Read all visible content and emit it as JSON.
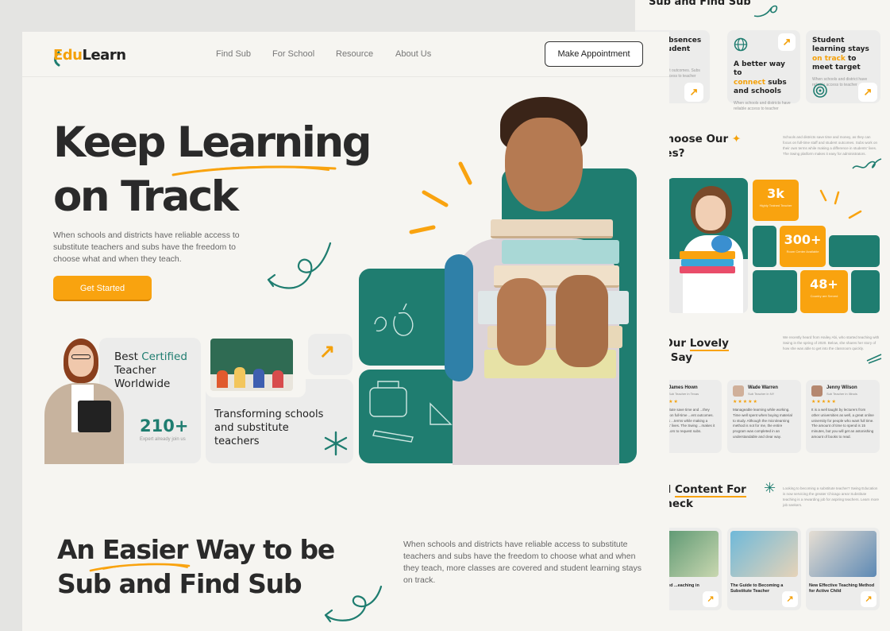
{
  "colors": {
    "accent": "#f9a30f",
    "teal": "#1f7d70",
    "background": "#f6f5f1"
  },
  "nav": {
    "logo_edu": "Edu",
    "logo_learn": "Learn",
    "links": [
      "Find Sub",
      "For School",
      "Resource",
      "About Us"
    ],
    "cta": "Make Appointment"
  },
  "hero": {
    "title_line1": "Keep Learning",
    "title_line2": "on Track",
    "description": "When schools and districts have reliable access to substitute teachers and subs have the freedom to choose what and when they teach.",
    "button": "Get Started"
  },
  "teacher_card": {
    "best": "Best",
    "certified": "Certified",
    "teacher": "Teacher",
    "worldwide": "Worldwide",
    "stat": "210+",
    "stat_label": "Expert already join us"
  },
  "transform_card": {
    "line1": "Transforming schools",
    "line2": "and substitute",
    "line3": "teachers"
  },
  "section2": {
    "line1": "An Easier Way to be",
    "line2": "Sub and Find Sub",
    "description": "When schools and districts have reliable access to substitute teachers and subs have the freedom to choose what and when they teach, more classes are covered and student learning stays on track."
  },
  "back": {
    "top_title": "Sub and Find Sub",
    "features": [
      {
        "pre": "her absences",
        "hl": "pt",
        "post": " student",
        "more": "ing",
        "desc": "...cpt student outcomes. Subs work ...in access to teacher"
      },
      {
        "pre": "A better way to",
        "hl": "connect",
        "post": " subs and schools",
        "desc": "When schools and districts have reliable access to teacher"
      },
      {
        "pre": "Student learning stays ",
        "hl": "on track",
        "post": " to meet target",
        "desc": "When schools and district have reliable access to teacher"
      }
    ],
    "why_title_1": "y Choose Our",
    "why_title_2": "vices?",
    "why_desc": "Schools and districts save time and money, as they can focus on full-time staff and student outcomes. Subs work on their own terms while making a difference in students' lives. The Swing platform makes it easy for administrators.",
    "stats": [
      {
        "num": "3k",
        "label": "Highly Trained Teacher"
      },
      {
        "num": "300+",
        "label": "Room Center Available"
      },
      {
        "num": "48+",
        "label": "Country are Served"
      }
    ],
    "say_title_1": "at Our",
    "say_title_hl": "Lovely",
    "say_title_2": "nts Say",
    "say_desc": "We recently heard from Hailey Abi, who started teaching with Swing in the spring of 2020. Below, she shares her story of how she was able to get into the classroom quickly.",
    "testimonials": [
      {
        "name": "James Hown",
        "role": "Sub Teacher in Texas",
        "stars": "★★★★★",
        "text": "...te substitute save time and ...they can focus on full-time ...ent outcomes. Subs work ...terms while making a ...students' lives. The Swing ...makes it easy for ...ors to request subs."
      },
      {
        "name": "Wade Warren",
        "role": "Sub Teacher in NY",
        "stars": "★★★★★",
        "text": "Manageable learning while working. Time well spent when buying material to study. Although the microlearning method is not for me, the entire program was completed in an understandable and clear way."
      },
      {
        "name": "Jenny Wilson",
        "role": "Sub Teacher in Illinois",
        "stars": "★★★★★",
        "text": "It is a well taught by lecturers from other universities as well, a great online university for people who want full time. The amount of time to spend is 15 minutes, but you will get an astonishing amount of books to read."
      }
    ],
    "content_title_1": "eful",
    "content_title_hl": "Content For",
    "content_title_2": "r Check",
    "content_desc": "Looking to becoming a substitute teacher? Swing Education is now servicing the greater Chicago area! Substitute teaching is a rewarding job for aspiring teachers. Learn more job seekers.",
    "blogs": [
      {
        "title": "ing helped ...eaching in"
      },
      {
        "title": "The Guide to Becoming a Substitute Teacher"
      },
      {
        "title": "New Effective Teaching Method for Active Child"
      }
    ]
  },
  "icons": [
    "arrow-up-right-icon",
    "globe-icon",
    "target-icon",
    "star-sparkle-icon",
    "squiggle-decoration"
  ]
}
